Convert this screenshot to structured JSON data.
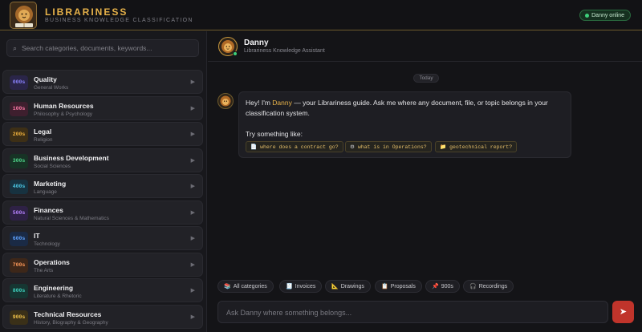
{
  "brand": {
    "title": "LIBRARINESS",
    "subtitle": "BUSINESS KNOWLEDGE CLASSIFICATION"
  },
  "status": {
    "label": "Danny online",
    "color": "#3ed07a"
  },
  "search": {
    "placeholder": "Search categories, documents, keywords..."
  },
  "categories": [
    {
      "code": "000s",
      "name": "Quality",
      "sub": "General Works",
      "color": "#8b83ff",
      "bg": "#2a2548"
    },
    {
      "code": "100s",
      "name": "Human Resources",
      "sub": "Philosophy & Psychology",
      "color": "#ff7aa8",
      "bg": "#3e1f2e"
    },
    {
      "code": "200s",
      "name": "Legal",
      "sub": "Religion",
      "color": "#f2b33d",
      "bg": "#3d2f16"
    },
    {
      "code": "300s",
      "name": "Business Development",
      "sub": "Social Sciences",
      "color": "#4fd68a",
      "bg": "#173325"
    },
    {
      "code": "400s",
      "name": "Marketing",
      "sub": "Language",
      "color": "#4cc9e6",
      "bg": "#173240"
    },
    {
      "code": "500s",
      "name": "Finances",
      "sub": "Natural Sciences & Mathematics",
      "color": "#b783ff",
      "bg": "#2e2145"
    },
    {
      "code": "600s",
      "name": "IT",
      "sub": "Technology",
      "color": "#5ea2ff",
      "bg": "#1a2a45"
    },
    {
      "code": "700s",
      "name": "Operations",
      "sub": "The Arts",
      "color": "#ff9a5a",
      "bg": "#3d2719"
    },
    {
      "code": "800s",
      "name": "Engineering",
      "sub": "Literature & Rhetoric",
      "color": "#3fd3bf",
      "bg": "#163632"
    },
    {
      "code": "900s",
      "name": "Technical Resources",
      "sub": "History, Biography & Geography",
      "color": "#f0c24a",
      "bg": "#3a3018"
    }
  ],
  "assistant": {
    "name": "Danny",
    "subtitle": "Librariness Knowledge Assistant"
  },
  "chat": {
    "day_label": "Today",
    "message": {
      "line1_before": "Hey! I'm ",
      "line1_name": "Danny",
      "line1_after": " — your Librariness guide. Ask me where any document, file, or topic belongs in your",
      "line2": "classification system.",
      "try_label": "Try something like:",
      "suggestions": [
        {
          "icon": "📄",
          "text": "where does a contract go?"
        },
        {
          "icon": "⚙",
          "text": "what is in Operations?"
        },
        {
          "icon": "📁",
          "text": "geotechnical report?"
        }
      ]
    }
  },
  "quick_chips": [
    {
      "icon": "📚",
      "label": "All categories"
    },
    {
      "icon": "🧾",
      "label": "Invoices"
    },
    {
      "icon": "📐",
      "label": "Drawings"
    },
    {
      "icon": "📋",
      "label": "Proposals"
    },
    {
      "icon": "📌",
      "label": "900s"
    },
    {
      "icon": "🎧",
      "label": "Recordings"
    }
  ],
  "composer": {
    "placeholder": "Ask Danny where something belongs...",
    "send_icon": "➤"
  }
}
